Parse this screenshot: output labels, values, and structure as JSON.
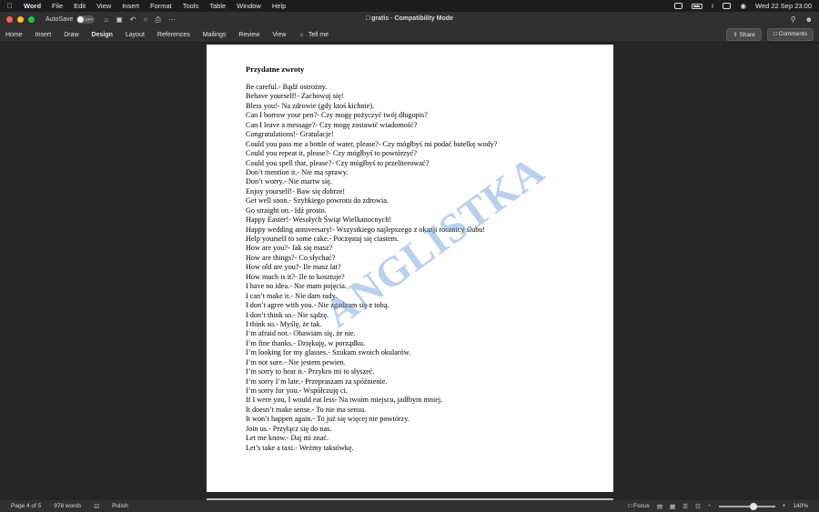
{
  "menubar": {
    "app": "Word",
    "items": [
      "File",
      "Edit",
      "View",
      "Insert",
      "Format",
      "Tools",
      "Table",
      "Window",
      "Help"
    ],
    "datetime": "Wed 22 Sep  23:00"
  },
  "titlebar": {
    "autosave_label": "AutoSave",
    "autosave_state": "OFF",
    "doc_name": "gratis",
    "mode": "Compatibility Mode"
  },
  "ribbon": {
    "tabs": [
      "Home",
      "Insert",
      "Draw",
      "Design",
      "Layout",
      "References",
      "Mailings",
      "Review",
      "View"
    ],
    "tell_me": "Tell me",
    "share": "Share",
    "comments": "Comments"
  },
  "document": {
    "heading": "Przydatne zwroty",
    "watermark": "ANGLISTKA",
    "lines": [
      "Be careful.- Bądź ostrożny.",
      "Behave yourself!- Zachowuj się!",
      "Bless you!- Na zdrowie (gdy ktoś kichnie).",
      "Can I borrow your pen?- Czy mogę pożyczyć twój długopis?",
      "Can I leave a message?- Czy mogę zostawić wiadomość?",
      "Congratulations!- Gratulacje!",
      "Could you pass me a bottle of water, please?- Czy mógłbyś  mi podać butelkę wody?",
      "Could you repeat it, please?- Czy mógłbyś to powtórzyć?",
      "Could you spell that, please?- Czy mógłbyś to przeliterować?",
      "Don’t mention it.- Nie ma sprawy.",
      "Don’t worry.- Nie martw się.",
      "Enjoy yourself!- Baw się dobrze!",
      "Get well soon.- Szybkiego powrotu do zdrowia.",
      "Go straight on.- Idź prosto.",
      "Happy Easter!- Wesołych Świąt Wielkanocnych!",
      "Happy wedding anniversary!- Wszystkiego najlepszego z okazji rocznicy ślubu!",
      "Help yourself to some cake.- Poczęstuj się ciastem.",
      "How are you?- Jak się masz?",
      "How are things?- Co słychać?",
      "How old are you?- Ile masz lat?",
      "How much is it?- Ile to kosztuje?",
      "I have no idea.- Nie mam pojęcia.",
      "I can’t make it.- Nie dam rady.",
      "I don’t agree with you.- Nie zgadzam się z tobą.",
      "I don’t think so.- Nie sądzę.",
      "I think so.- Myślę, że tak.",
      "I’m afraid not.- Obawiam się, że nie.",
      "I’m fine thanks.- Dziękuję,  w porządku.",
      "I’m looking for my glasses.- Szukam swoich okularów.",
      "I’m not sure.- Nie jestem pewien.",
      "I’m sorry to hear it.- Przykro mi to słyszeć.",
      "I’m sorry I’m late.- Przepraszam za spóźnienie.",
      "I’m sorry for you.- Współczuję ci.",
      "If I were you, I would eat less- Na twoim miejscu, jadłbym mniej.",
      "It doesn’t make sense.- To nie ma sensu.",
      "It won’t happen again.- To już się więcej nie powtórzy.",
      "Join us.- Przyłącz się do nas.",
      "Let me know.- Daj mi znać.",
      "Let’s take a taxi.- Weźmy taksówkę."
    ]
  },
  "statusbar": {
    "page": "Page 4 of 5",
    "words": "978 words",
    "language": "Polish",
    "focus": "Focus",
    "zoom": "140%"
  },
  "icons": {
    "apple": "apple-icon",
    "home": "home-icon",
    "save": "save-icon",
    "undo": "undo-icon",
    "print": "print-icon",
    "search": "search-icon",
    "lightbulb": "lightbulb-icon"
  }
}
